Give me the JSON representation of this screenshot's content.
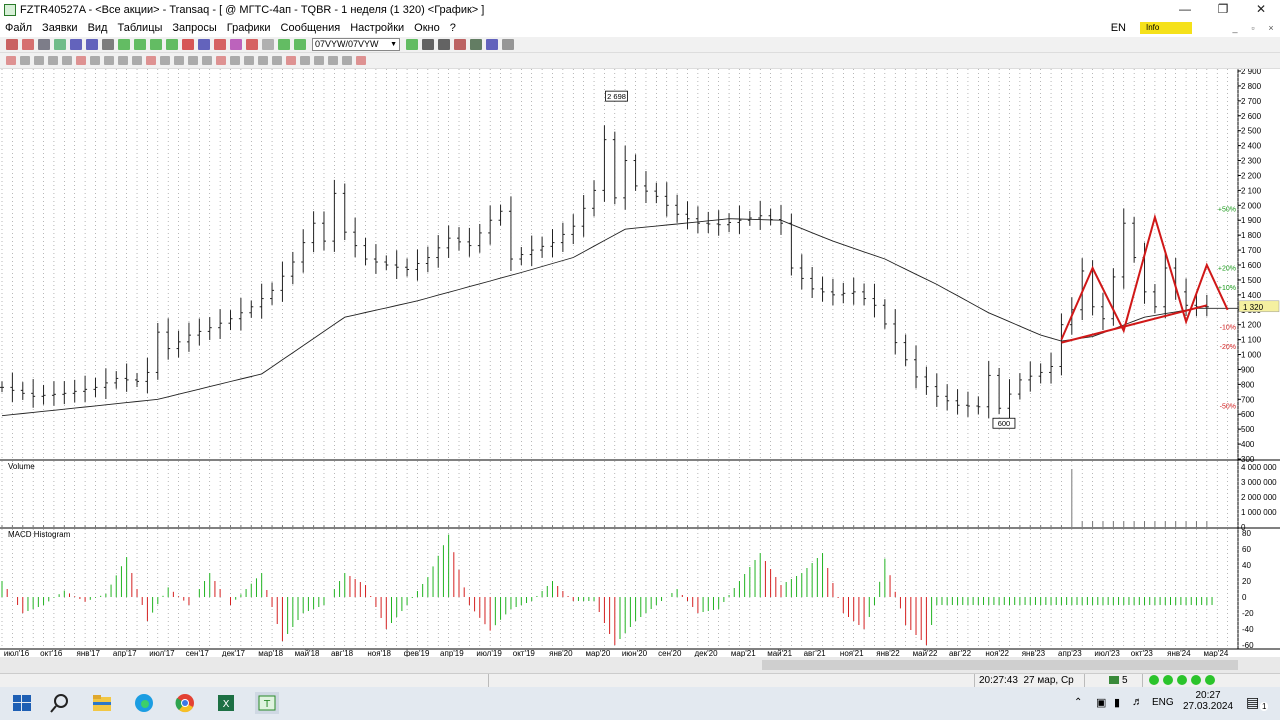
{
  "window": {
    "title": "FZTR40527A - <Все акции> - Transaq - [ @ МГТС-4ап - TQBR - 1 неделя (1 320) <График> ]"
  },
  "menu": [
    "Файл",
    "Заявки",
    "Вид",
    "Таблицы",
    "Запросы",
    "Графики",
    "Сообщения",
    "Настройки",
    "Окно",
    "?"
  ],
  "menu_right": {
    "lang": "EN",
    "info_label": "Info"
  },
  "toolbar": {
    "timeframe_select": "07VYW/07VYW"
  },
  "panes": {
    "volume_label": "Volume",
    "macd_label": "MACD Histogram"
  },
  "chart_data": {
    "type": "candlestick",
    "symbol": "МГТС-4ап",
    "board": "TQBR",
    "interval": "1 неделя",
    "last_price": "1 320",
    "annotations": {
      "high": "2 698",
      "low": "600"
    },
    "price_axis": {
      "ylim": [
        300,
        2900
      ],
      "ticks": [
        "2 900",
        "2 800",
        "2 700",
        "2 600",
        "2 500",
        "2 400",
        "2 300",
        "2 200",
        "2 100",
        "2 000",
        "1 900",
        "1 800",
        "1 700",
        "1 600",
        "1 500",
        "1 400",
        "1 300",
        "1 200",
        "1 100",
        "1 000",
        "900",
        "800",
        "700",
        "600",
        "500",
        "400",
        "300"
      ]
    },
    "percent_levels": [
      {
        "label": "+50%",
        "price": 1980
      },
      {
        "label": "+20%",
        "price": 1584
      },
      {
        "label": "+10%",
        "price": 1452
      },
      {
        "label": "-10%",
        "price": 1188
      },
      {
        "label": "-20%",
        "price": 1056
      },
      {
        "label": "-50%",
        "price": 660
      }
    ],
    "volume_axis": {
      "ticks": [
        "4 000 000",
        "3 000 000",
        "2 000 000",
        "1 000 000",
        "0"
      ],
      "ylim": [
        0,
        4000000
      ]
    },
    "macd_axis": {
      "ticks": [
        "80",
        "60",
        "40",
        "20",
        "0",
        "-20",
        "-40",
        "-60"
      ],
      "ylim": [
        -65,
        85
      ]
    },
    "x_ticks": [
      "июл'16",
      "окт'16",
      "янв'17",
      "апр'17",
      "июл'17",
      "сен'17",
      "дек'17",
      "мар'18",
      "май'18",
      "авг'18",
      "ноя'18",
      "фев'19",
      "апр'19",
      "июл'19",
      "окт'19",
      "янв'20",
      "мар'20",
      "июн'20",
      "сен'20",
      "дек'20",
      "мар'21",
      "май'21",
      "авг'21",
      "ноя'21",
      "янв'22",
      "май'22",
      "авг'22",
      "ноя'22",
      "янв'23",
      "апр'23",
      "июл'23",
      "окт'23",
      "янв'24",
      "мар'24"
    ],
    "price_path": [
      [
        0,
        780
      ],
      [
        3,
        720
      ],
      [
        6,
        740
      ],
      [
        9,
        780
      ],
      [
        11,
        840
      ],
      [
        13,
        820
      ],
      [
        14,
        880
      ],
      [
        15,
        1150
      ],
      [
        16,
        1040
      ],
      [
        18,
        1130
      ],
      [
        20,
        1180
      ],
      [
        22,
        1240
      ],
      [
        24,
        1320
      ],
      [
        26,
        1430
      ],
      [
        28,
        1620
      ],
      [
        30,
        1880
      ],
      [
        31,
        1760
      ],
      [
        32,
        2080
      ],
      [
        33,
        1820
      ],
      [
        35,
        1640
      ],
      [
        37,
        1600
      ],
      [
        39,
        1570
      ],
      [
        41,
        1650
      ],
      [
        43,
        1780
      ],
      [
        45,
        1730
      ],
      [
        47,
        1900
      ],
      [
        48,
        1960
      ],
      [
        49,
        1640
      ],
      [
        51,
        1700
      ],
      [
        53,
        1750
      ],
      [
        55,
        1860
      ],
      [
        57,
        2100
      ],
      [
        58,
        2440
      ],
      [
        59,
        2050
      ],
      [
        60,
        2300
      ],
      [
        61,
        2130
      ],
      [
        63,
        2060
      ],
      [
        65,
        1940
      ],
      [
        67,
        1880
      ],
      [
        69,
        1870
      ],
      [
        71,
        1900
      ],
      [
        73,
        1930
      ],
      [
        75,
        1880
      ],
      [
        76,
        1580
      ],
      [
        78,
        1440
      ],
      [
        80,
        1400
      ],
      [
        82,
        1420
      ],
      [
        84,
        1330
      ],
      [
        86,
        1080
      ],
      [
        88,
        850
      ],
      [
        90,
        720
      ],
      [
        92,
        660
      ],
      [
        94,
        650
      ],
      [
        95,
        860
      ],
      [
        96,
        640
      ],
      [
        98,
        830
      ],
      [
        100,
        880
      ],
      [
        101,
        920
      ],
      [
        102,
        1200
      ],
      [
        103,
        1300
      ],
      [
        104,
        1560
      ],
      [
        105,
        1320
      ],
      [
        106,
        1240
      ],
      [
        107,
        1520
      ],
      [
        108,
        1880
      ],
      [
        109,
        1650
      ],
      [
        110,
        1420
      ],
      [
        111,
        1320
      ],
      [
        112,
        1580
      ],
      [
        113,
        1420
      ],
      [
        114,
        1330
      ],
      [
        115,
        1320
      ]
    ],
    "ma_path": [
      [
        0,
        590
      ],
      [
        15,
        700
      ],
      [
        25,
        870
      ],
      [
        33,
        1250
      ],
      [
        40,
        1360
      ],
      [
        50,
        1550
      ],
      [
        55,
        1650
      ],
      [
        60,
        1840
      ],
      [
        70,
        1910
      ],
      [
        75,
        1900
      ],
      [
        80,
        1760
      ],
      [
        85,
        1640
      ],
      [
        90,
        1470
      ],
      [
        95,
        1280
      ],
      [
        100,
        1130
      ],
      [
        102,
        1090
      ],
      [
        105,
        1120
      ],
      [
        110,
        1250
      ],
      [
        115,
        1310
      ]
    ],
    "support_line": [
      [
        102,
        1080
      ],
      [
        116,
        1330
      ]
    ],
    "pattern_zigzag": [
      [
        102,
        1100
      ],
      [
        105,
        1580
      ],
      [
        108,
        1160
      ],
      [
        111,
        1920
      ],
      [
        114,
        1220
      ],
      [
        116,
        1600
      ],
      [
        118,
        1300
      ]
    ],
    "macd_path": [
      [
        0,
        20
      ],
      [
        2,
        -20
      ],
      [
        4,
        -10
      ],
      [
        6,
        8
      ],
      [
        8,
        -6
      ],
      [
        10,
        4
      ],
      [
        12,
        50
      ],
      [
        14,
        -30
      ],
      [
        16,
        12
      ],
      [
        18,
        -10
      ],
      [
        20,
        30
      ],
      [
        22,
        -10
      ],
      [
        25,
        30
      ],
      [
        27,
        -55
      ],
      [
        29,
        -20
      ],
      [
        31,
        -10
      ],
      [
        33,
        30
      ],
      [
        35,
        15
      ],
      [
        37,
        -40
      ],
      [
        39,
        -10
      ],
      [
        41,
        25
      ],
      [
        43,
        78
      ],
      [
        45,
        -10
      ],
      [
        47,
        -42
      ],
      [
        49,
        -15
      ],
      [
        51,
        -5
      ],
      [
        53,
        20
      ],
      [
        55,
        -5
      ],
      [
        57,
        -5
      ],
      [
        59,
        -60
      ],
      [
        61,
        -30
      ],
      [
        63,
        -10
      ],
      [
        65,
        10
      ],
      [
        67,
        -20
      ],
      [
        69,
        -15
      ],
      [
        71,
        20
      ],
      [
        73,
        55
      ],
      [
        75,
        15
      ],
      [
        77,
        30
      ],
      [
        79,
        55
      ],
      [
        81,
        -20
      ],
      [
        83,
        -40
      ],
      [
        84,
        -10
      ],
      [
        85,
        48
      ],
      [
        87,
        -35
      ],
      [
        89,
        -60
      ],
      [
        90,
        -10
      ]
    ]
  },
  "status": {
    "time": "20:27:43",
    "date": "27 мар, Ср",
    "connections": "5"
  },
  "taskbar": {
    "lang": "ENG",
    "clock_time": "20:27",
    "clock_date": "27.03.2024",
    "notif_count": "1"
  }
}
